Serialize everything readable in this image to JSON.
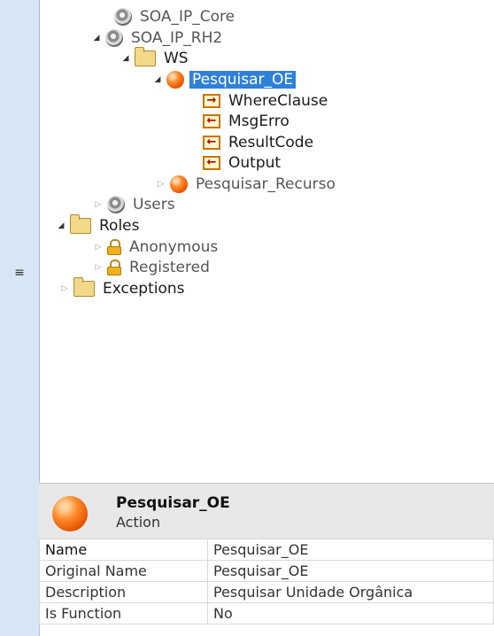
{
  "tree": {
    "nodes": [
      {
        "label": "SOA_IP_Core"
      },
      {
        "label": "SOA_IP_RH2"
      },
      {
        "label": "WS"
      },
      {
        "label": "Pesquisar_OE"
      },
      {
        "label": "WhereClause"
      },
      {
        "label": "MsgErro"
      },
      {
        "label": "ResultCode"
      },
      {
        "label": "Output"
      },
      {
        "label": "Pesquisar_Recurso"
      },
      {
        "label": "Users"
      },
      {
        "label": "Roles"
      },
      {
        "label": "Anonymous"
      },
      {
        "label": "Registered"
      },
      {
        "label": "Exceptions"
      }
    ],
    "expander": {
      "expanded": "◢",
      "collapsed": "▷"
    },
    "splitter_glyph": "≡"
  },
  "header": {
    "title": "Pesquisar_OE",
    "subtitle": "Action"
  },
  "properties": [
    {
      "name": "Name",
      "value": "Pesquisar_OE"
    },
    {
      "name": "Original Name",
      "value": "Pesquisar_OE"
    },
    {
      "name": "Description",
      "value": "Pesquisar Unidade Orgânica"
    },
    {
      "name": "Is Function",
      "value": "No"
    }
  ]
}
